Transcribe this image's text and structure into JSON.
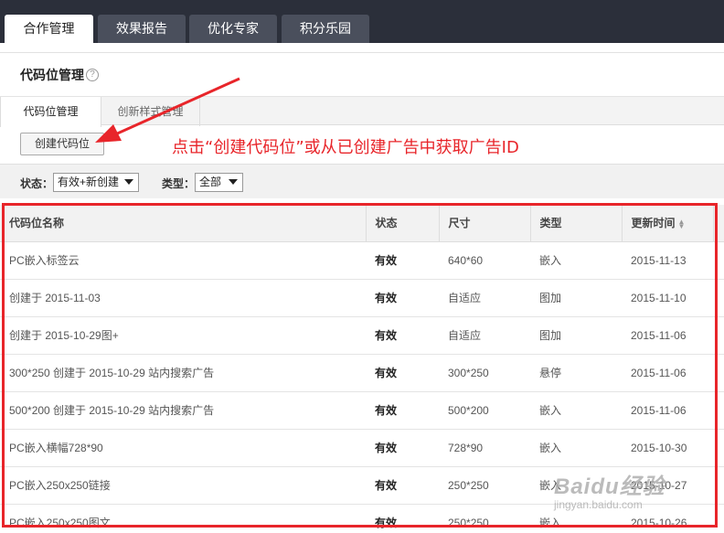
{
  "top_tabs": [
    {
      "label": "合作管理",
      "active": true
    },
    {
      "label": "效果报告",
      "active": false
    },
    {
      "label": "优化专家",
      "active": false
    },
    {
      "label": "积分乐园",
      "active": false
    }
  ],
  "page": {
    "title": "代码位管理",
    "help_icon": "question-icon"
  },
  "sub_tabs": [
    {
      "label": "代码位管理",
      "active": true
    },
    {
      "label": "创新样式管理",
      "active": false
    }
  ],
  "toolbar": {
    "create_label": "创建代码位"
  },
  "annotation": {
    "text": "点击“创建代码位”或从已创建广告中获取广告ID",
    "color": "#e8252a"
  },
  "filters": {
    "status_label": "状态：",
    "status_value": "有效+新创建",
    "type_label": "类型：",
    "type_value": "全部"
  },
  "table": {
    "headers": [
      "代码位名称",
      "状态",
      "尺寸",
      "类型",
      "更新时间"
    ],
    "rows": [
      {
        "name": "PC嵌入标签云",
        "status": "有效",
        "size": "640*60",
        "type": "嵌入",
        "updated": "2015-11-13"
      },
      {
        "name": "创建于 2015-11-03",
        "status": "有效",
        "size": "自适应",
        "type": "图加",
        "updated": "2015-11-10"
      },
      {
        "name": "创建于 2015-10-29图+",
        "status": "有效",
        "size": "自适应",
        "type": "图加",
        "updated": "2015-11-06"
      },
      {
        "name": "300*250 创建于 2015-10-29 站内搜索广告",
        "status": "有效",
        "size": "300*250",
        "type": "悬停",
        "updated": "2015-11-06"
      },
      {
        "name": "500*200 创建于 2015-10-29 站内搜索广告",
        "status": "有效",
        "size": "500*200",
        "type": "嵌入",
        "updated": "2015-11-06"
      },
      {
        "name": "PC嵌入横幅728*90",
        "status": "有效",
        "size": "728*90",
        "type": "嵌入",
        "updated": "2015-10-30"
      },
      {
        "name": "PC嵌入250x250链接",
        "status": "有效",
        "size": "250*250",
        "type": "嵌入",
        "updated": "2015-10-27"
      },
      {
        "name": "PC嵌入250x250图文",
        "status": "有效",
        "size": "250*250",
        "type": "嵌入",
        "updated": "2015-10-26"
      }
    ]
  },
  "watermark": {
    "brand": "Baidu经验",
    "url": "jingyan.baidu.com"
  }
}
